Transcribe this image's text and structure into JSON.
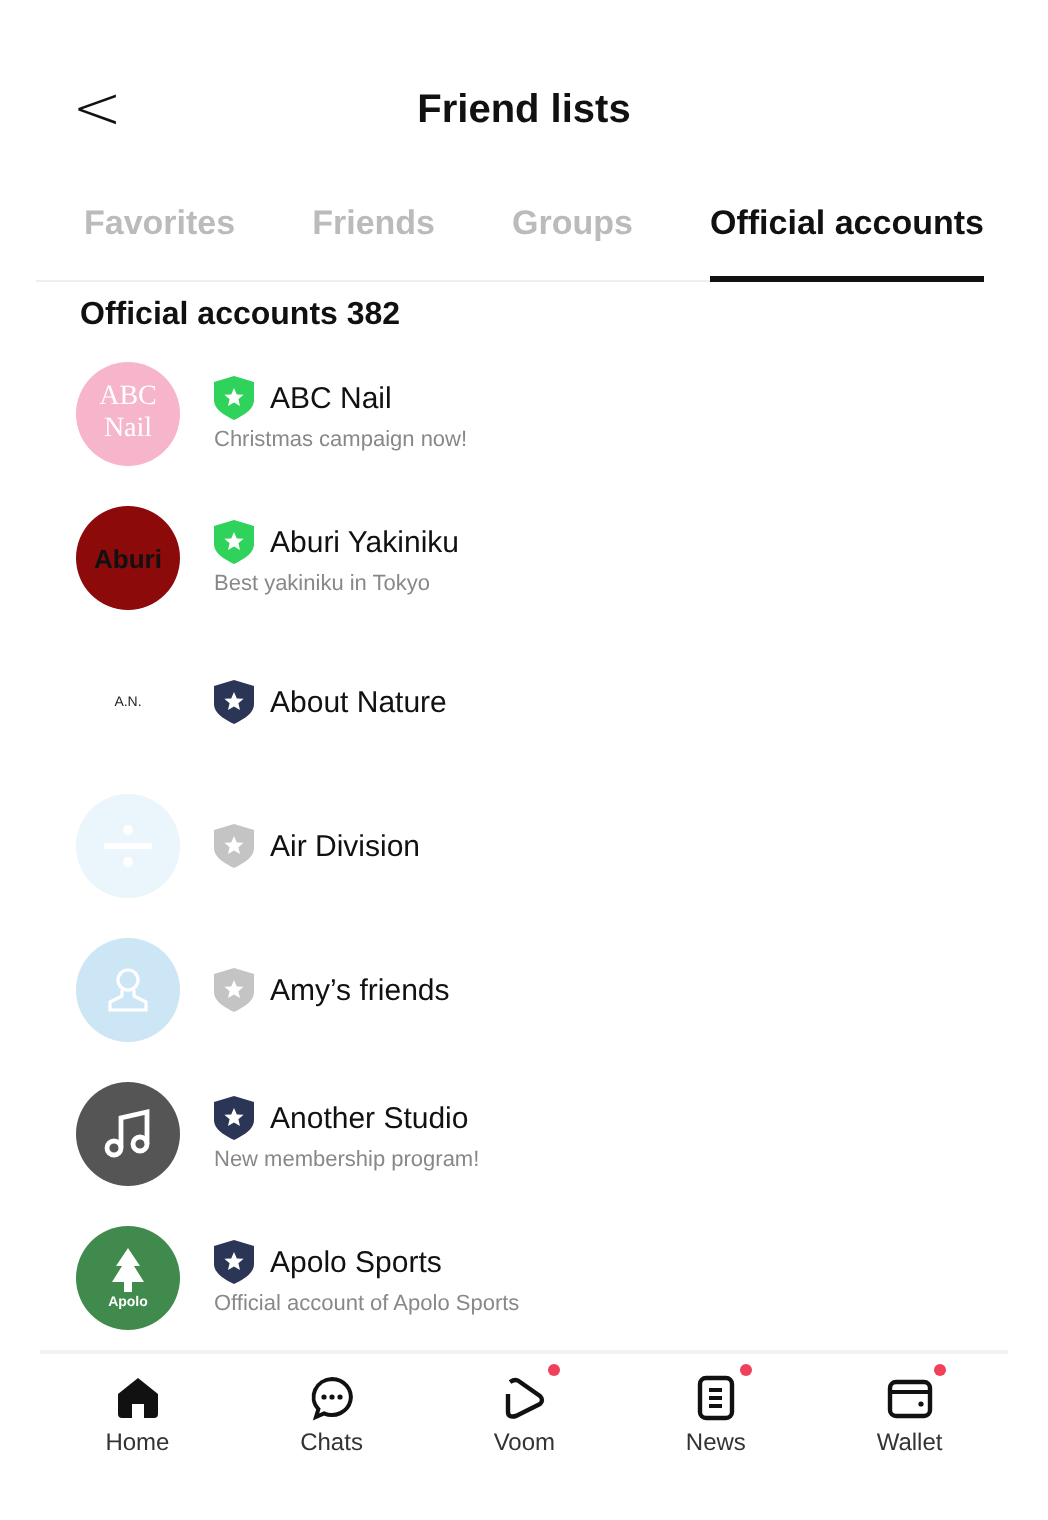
{
  "header": {
    "back": "<",
    "title": "Friend lists"
  },
  "tabs": [
    {
      "label": "Favorites",
      "selected": false
    },
    {
      "label": "Friends",
      "selected": false
    },
    {
      "label": "Groups",
      "selected": false
    },
    {
      "label": "Official accounts",
      "selected": true
    }
  ],
  "section_title": "Official accounts 382",
  "accounts": [
    {
      "name": "ABC Nail",
      "subtitle": "Christmas campaign now!",
      "color": "#2fd25a",
      "avatar": {
        "kind": "text",
        "text": "ABC Nail",
        "color": "#f7b5cb"
      }
    },
    {
      "name": "Aburi Yakiniku",
      "subtitle": "Best yakiniku in Tokyo",
      "color": "#2fd25a",
      "avatar": {
        "kind": "text",
        "text": "Aburi",
        "color": "#8c0a0a"
      }
    },
    {
      "name": "About Nature",
      "color": "#2b3556",
      "avatar": {
        "kind": "small-text",
        "text": "A.N."
      }
    },
    {
      "name": "Air Division",
      "color": "#c4c4c4",
      "avatar": {
        "kind": "divide",
        "color": "#eaf5fc"
      }
    },
    {
      "name": "Amy’s friends",
      "color": "#c4c4c4",
      "avatar": {
        "kind": "person",
        "color": "#cde6f6"
      }
    },
    {
      "name": "Another Studio",
      "subtitle": "New membership program!",
      "color": "#2b3556",
      "avatar": {
        "kind": "music",
        "color": "#555555"
      }
    },
    {
      "name": "Apolo Sports",
      "subtitle": "Official account of Apolo Sports",
      "color": "#2b3556",
      "avatar": {
        "kind": "tree",
        "text": "Apolo",
        "color": "#3f8a4c"
      }
    }
  ],
  "nav": [
    {
      "kind": "home",
      "label": "Home",
      "dot": false
    },
    {
      "kind": "chats",
      "label": "Chats",
      "dot": false
    },
    {
      "kind": "voom",
      "label": "Voom",
      "dot": true
    },
    {
      "kind": "news",
      "label": "News",
      "dot": true
    },
    {
      "kind": "wallet",
      "label": "Wallet",
      "dot": true
    }
  ]
}
